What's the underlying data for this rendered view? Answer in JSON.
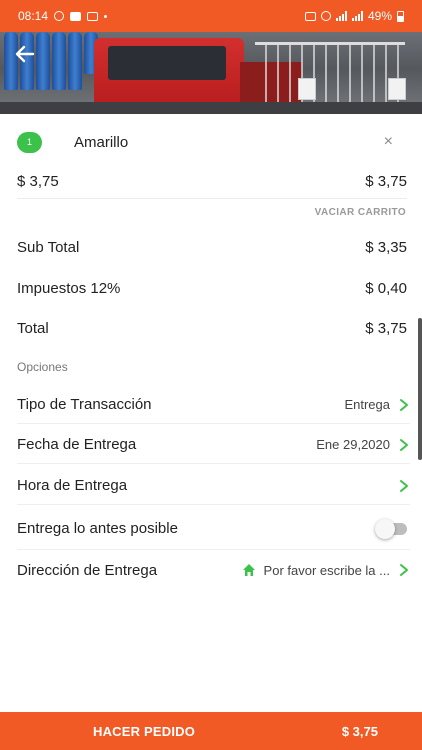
{
  "status_bar": {
    "time": "08:14",
    "battery": "49%"
  },
  "item": {
    "quantity": "1",
    "name": "Amarillo",
    "remove_glyph": "×",
    "price_left": "$ 3,75",
    "price_right": "$ 3,75"
  },
  "cart": {
    "empty_label": "VACIAR CARRITO"
  },
  "summary": {
    "subtotal_label": "Sub Total",
    "subtotal_value": "$ 3,35",
    "tax_label": "Impuestos 12%",
    "tax_value": "$ 0,40",
    "total_label": "Total",
    "total_value": "$ 3,75"
  },
  "options": {
    "section_label": "Opciones",
    "transaction_type_label": "Tipo de Transacción",
    "transaction_type_value": "Entrega",
    "delivery_date_label": "Fecha de Entrega",
    "delivery_date_value": "Ene 29,2020",
    "delivery_time_label": "Hora de Entrega",
    "asap_label": "Entrega lo antes posible",
    "asap_enabled": false,
    "address_label": "Dirección de Entrega",
    "address_placeholder": "Por favor escribe la ..."
  },
  "footer": {
    "order_button": "HACER PEDIDO",
    "total": "$ 3,75"
  },
  "colors": {
    "brand": "#f15a24",
    "accent_green": "#3cc14b",
    "text": "#222222",
    "muted": "#9a9a9a"
  },
  "icons": {
    "back": "arrow-left-icon",
    "remove": "close-icon",
    "chevron": "chevron-right-icon",
    "home": "home-icon"
  }
}
